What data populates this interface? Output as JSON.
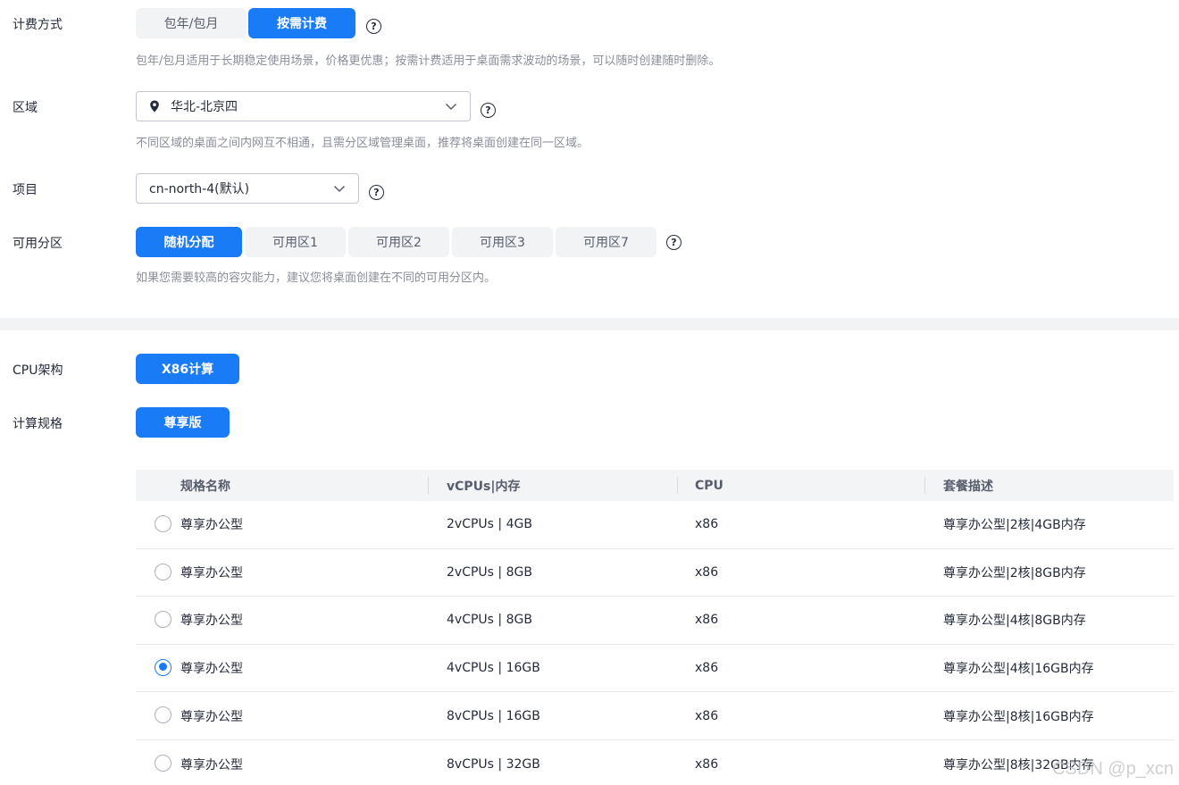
{
  "billing": {
    "label": "计费方式",
    "options": [
      "包年/包月",
      "按需计费"
    ],
    "selected": "按需计费",
    "hint": "包年/包月适用于长期稳定使用场景，价格更优惠；按需计费适用于桌面需求波动的场景，可以随时创建随时删除。"
  },
  "region": {
    "label": "区域",
    "value": "华北-北京四",
    "hint": "不同区域的桌面之间内网互不相通，且需分区域管理桌面，推荐将桌面创建在同一区域。"
  },
  "project": {
    "label": "项目",
    "value": "cn-north-4(默认)"
  },
  "az": {
    "label": "可用分区",
    "options": [
      "随机分配",
      "可用区1",
      "可用区2",
      "可用区3",
      "可用区7"
    ],
    "selected": "随机分配",
    "hint": "如果您需要较高的容灾能力，建议您将桌面创建在不同的可用分区内。"
  },
  "cpu_arch": {
    "label": "CPU架构",
    "value": "X86计算"
  },
  "flavor_type": {
    "label": "计算规格",
    "value": "尊享版"
  },
  "help_glyph": "?",
  "table": {
    "columns": [
      "规格名称",
      "vCPUs|内存",
      "CPU",
      "套餐描述"
    ],
    "rows": [
      {
        "name": "尊享办公型",
        "spec": "2vCPUs | 4GB",
        "cpu": "x86",
        "desc": "尊享办公型|2核|4GB内存",
        "selected": false
      },
      {
        "name": "尊享办公型",
        "spec": "2vCPUs | 8GB",
        "cpu": "x86",
        "desc": "尊享办公型|2核|8GB内存",
        "selected": false
      },
      {
        "name": "尊享办公型",
        "spec": "4vCPUs | 8GB",
        "cpu": "x86",
        "desc": "尊享办公型|4核|8GB内存",
        "selected": false
      },
      {
        "name": "尊享办公型",
        "spec": "4vCPUs | 16GB",
        "cpu": "x86",
        "desc": "尊享办公型|4核|16GB内存",
        "selected": true
      },
      {
        "name": "尊享办公型",
        "spec": "8vCPUs | 16GB",
        "cpu": "x86",
        "desc": "尊享办公型|8核|16GB内存",
        "selected": false
      },
      {
        "name": "尊享办公型",
        "spec": "8vCPUs | 32GB",
        "cpu": "x86",
        "desc": "尊享办公型|8核|32GB内存",
        "selected": false
      }
    ]
  },
  "watermark": "CSDN @p_xcn",
  "colors": {
    "accent": "#1a7bf7",
    "hint_text": "#8a8e99",
    "segment_off": "#f2f3f5"
  }
}
